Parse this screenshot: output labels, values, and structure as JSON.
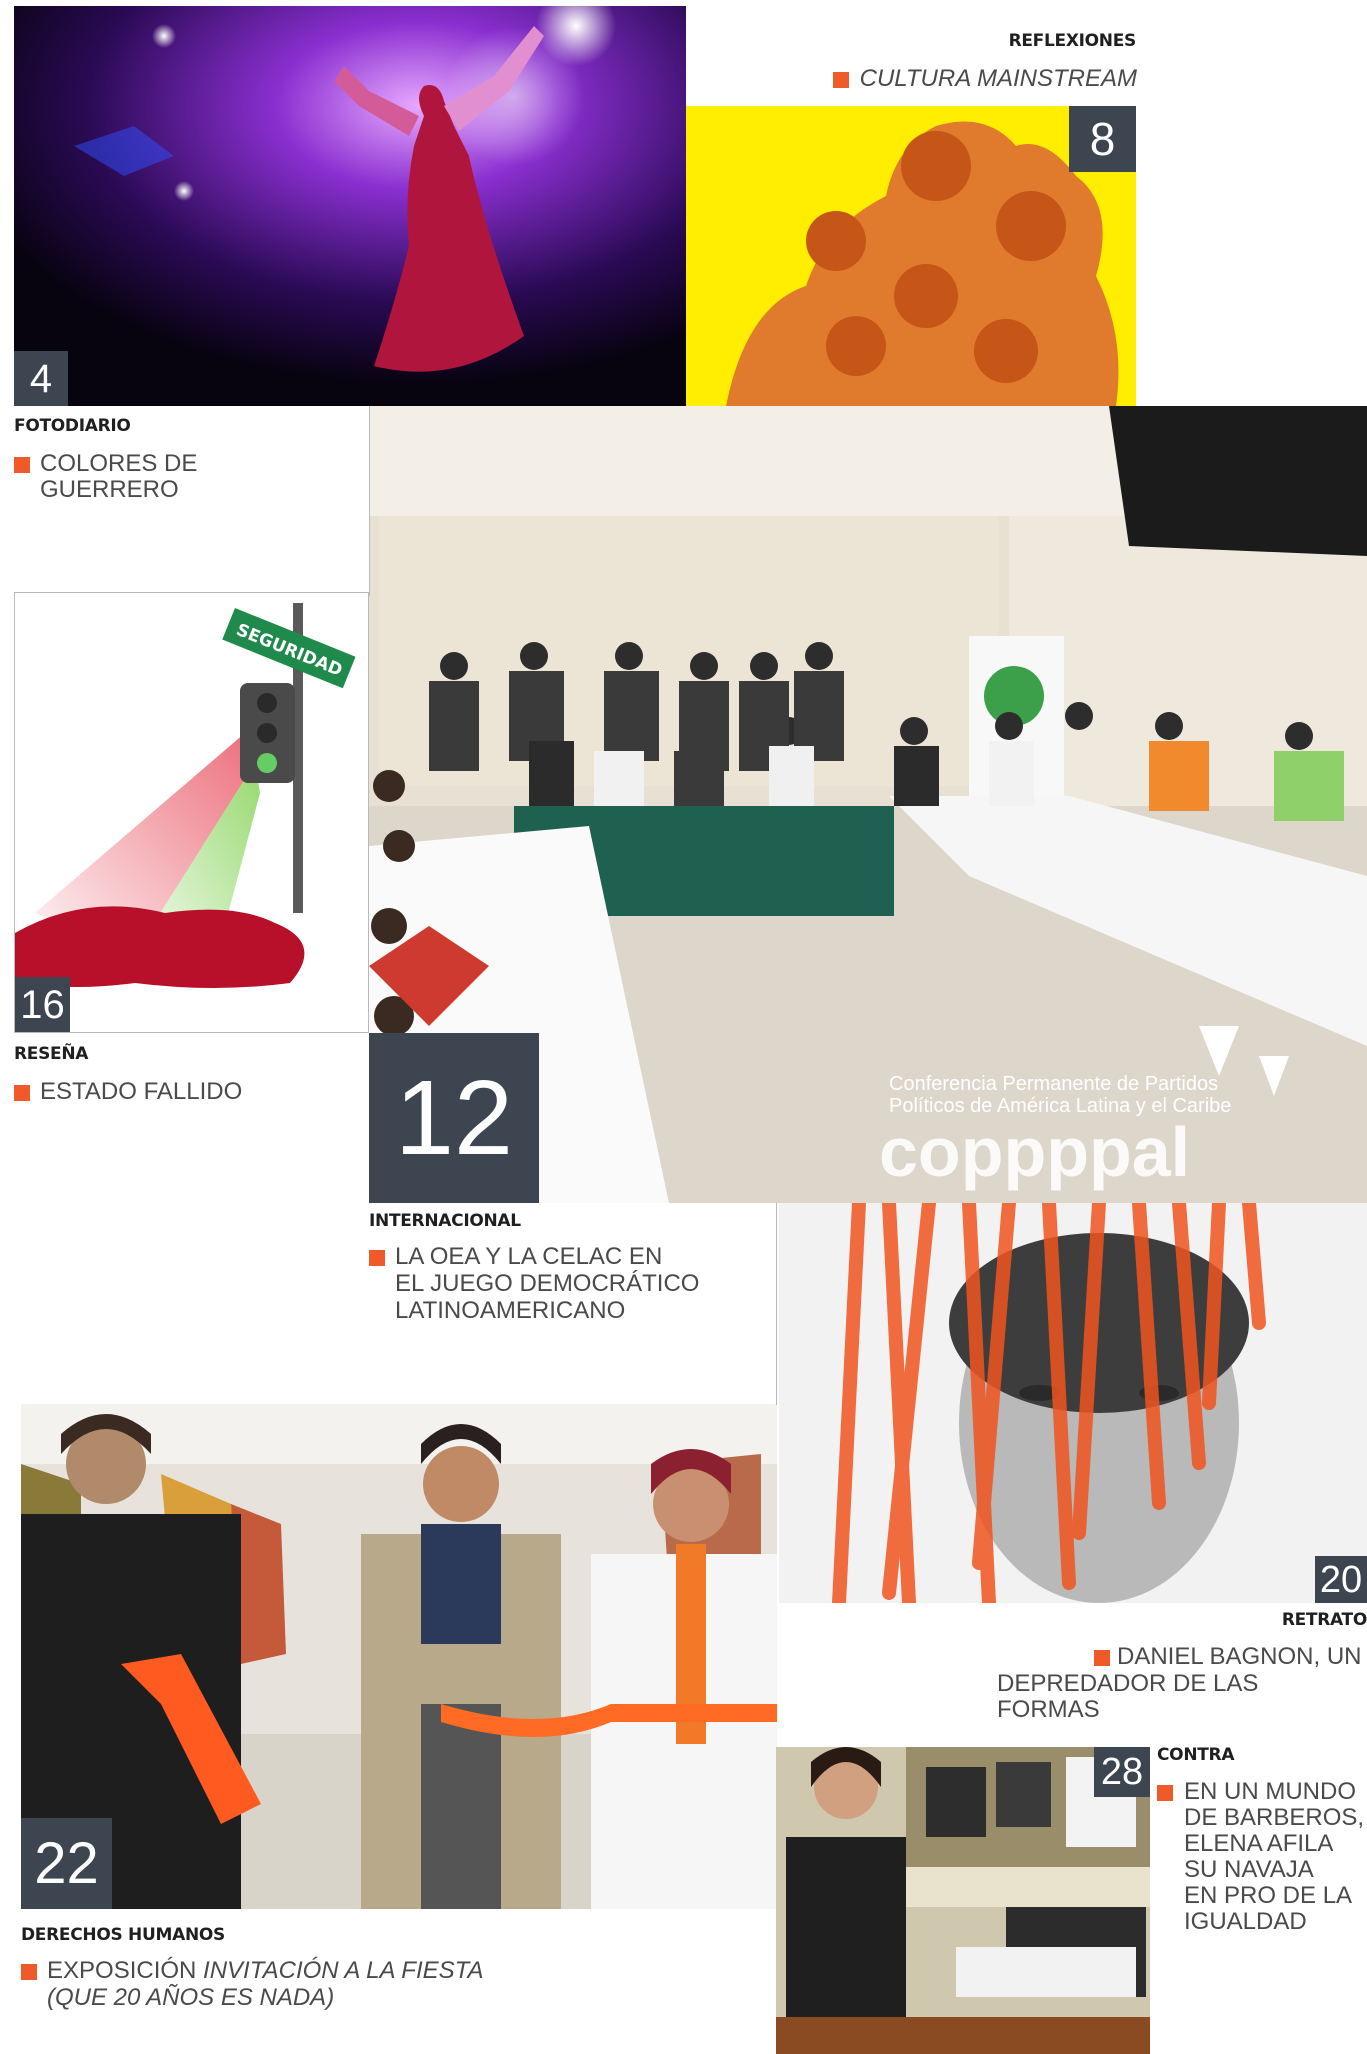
{
  "articles": {
    "fotodiario": {
      "number": "4",
      "section": "FOTODIARIO",
      "headline_line1": "COLORES DE",
      "headline_line2": "GUERRERO"
    },
    "reflexiones": {
      "number": "8",
      "section": "REFLEXIONES",
      "headline": "CULTURA MAINSTREAM"
    },
    "internacional": {
      "number": "12",
      "section": "INTERNACIONAL",
      "headline_line1": "LA OEA Y LA CELAC EN",
      "headline_line2": "EL JUEGO DEMOCRÁTICO",
      "headline_line3": "LATINOAMERICANO",
      "banner_line1": "Conferencia Permanente de Partidos",
      "banner_line2": "Políticos de América Latina y el Caribe",
      "logo": "coppppal"
    },
    "resena": {
      "number": "16",
      "section": "RESEÑA",
      "headline": "ESTADO FALLIDO",
      "sign_text": "SEGURIDAD"
    },
    "retrato": {
      "number": "20",
      "section": "RETRATO",
      "headline_line1": "DANIEL BAGNON, UN",
      "headline_line2": "DEPREDADOR DE LAS FORMAS"
    },
    "derechos": {
      "number": "22",
      "section": "DERECHOS HUMANOS",
      "headline_plain": "EXPOSICIÓN ",
      "headline_italic1": "INVITACIÓN A LA FIESTA",
      "headline_italic2": "(QUE 20 AÑOS ES NADA)"
    },
    "contra": {
      "number": "28",
      "section": "CONTRA",
      "headline_line1": "EN UN MUNDO",
      "headline_line2": "DE BARBEROS,",
      "headline_line3": "ELENA AFILA",
      "headline_line4": "SU NAVAJA",
      "headline_line5": "EN PRO DE LA",
      "headline_line6": "IGUALDAD"
    }
  },
  "colors": {
    "accent": "#f05a28",
    "number_box": "#3d4650",
    "yellow": "#ffee00"
  }
}
